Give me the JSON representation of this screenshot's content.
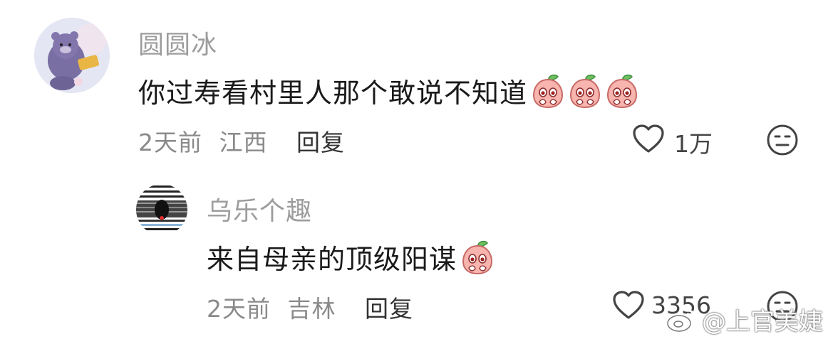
{
  "comments": [
    {
      "username": "圆圆冰",
      "text": "你过寿看村里人那个敢说不知道",
      "time": "2天前",
      "location": "江西",
      "reply_label": "回复",
      "likes": "1万",
      "emoji_count": 3,
      "emoji_name": "peach-face-emoji"
    },
    {
      "username": "乌乐个趣",
      "text": "来自母亲的顶级阳谋",
      "time": "2天前",
      "location": "吉林",
      "reply_label": "回复",
      "likes": "3356",
      "emoji_count": 1,
      "emoji_name": "peach-face-emoji"
    }
  ],
  "watermark": {
    "text": "@上官美婕",
    "icon": "weibo-logo-icon"
  },
  "colors": {
    "username": "#9d9d9d",
    "comment_text": "#1a1a1a",
    "meta": "#8a8a8a",
    "icon": "#444444",
    "peach_pink": "#f6a6a0",
    "peach_leaf": "#5fb45a"
  }
}
